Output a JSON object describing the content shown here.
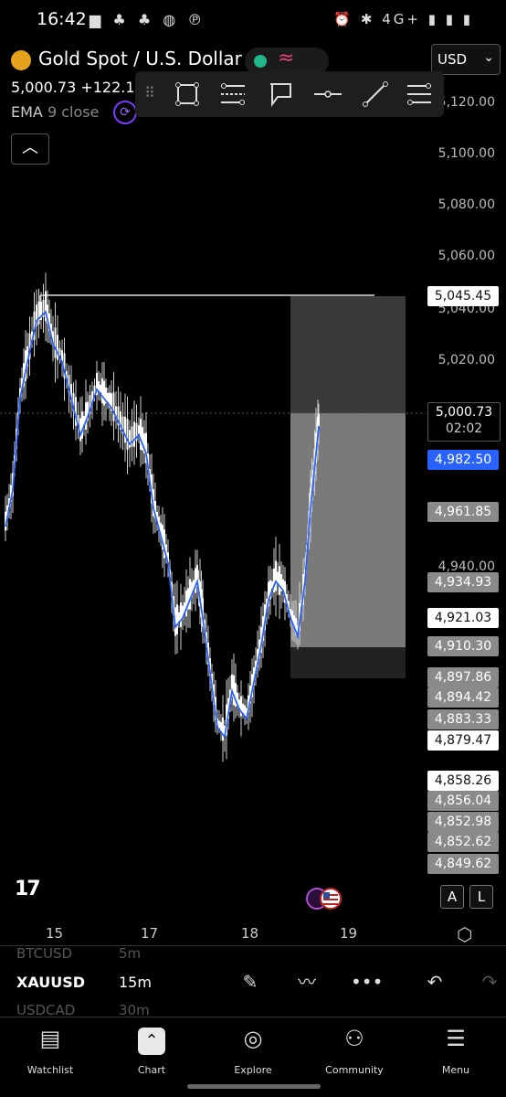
{
  "status": {
    "time": "16:42",
    "left_icons": "▆ ♣ ♣ ◍ ℗",
    "right_icons": "⏰ ✱ 4G+ ▮ ▮ ▮"
  },
  "header": {
    "title": "Gold Spot / U.S. Dollar",
    "price": "5,000.73",
    "change": "+122.12",
    "indicator": "EMA",
    "indicator_period": "9",
    "indicator_source": "close",
    "currency": "USD"
  },
  "price_axis": {
    "labels": [
      "5,120.00",
      "5,100.00",
      "5,080.00",
      "5,060.00",
      "5,040.00",
      "5,020.00",
      "4,940.00"
    ]
  },
  "price_tags": [
    {
      "value": "5,045.45",
      "style": "white"
    },
    {
      "value": "4,982.50",
      "style": "blue"
    },
    {
      "value": "4,961.85",
      "style": "gray"
    },
    {
      "value": "4,934.93",
      "style": "gray"
    },
    {
      "value": "4,921.03",
      "style": "white"
    },
    {
      "value": "4,910.30",
      "style": "gray"
    },
    {
      "value": "4,897.86",
      "style": "gray"
    },
    {
      "value": "4,894.42",
      "style": "gray"
    },
    {
      "value": "4,883.33",
      "style": "gray"
    },
    {
      "value": "4,879.47",
      "style": "white"
    },
    {
      "value": "4,858.26",
      "style": "white"
    },
    {
      "value": "4,856.04",
      "style": "gray"
    },
    {
      "value": "4,852.98",
      "style": "gray"
    },
    {
      "value": "4,852.62",
      "style": "gray"
    },
    {
      "value": "4,849.62",
      "style": "gray"
    }
  ],
  "current_price": {
    "value": "5,000.73",
    "countdown": "02:02"
  },
  "time_axis": {
    "labels": [
      "15",
      "17",
      "18",
      "19"
    ]
  },
  "chart_buttons": {
    "alert": "A",
    "log": "L"
  },
  "logo_text": "17",
  "symbols": {
    "prev_symbol": "BTCUSD",
    "prev_interval": "5m",
    "symbol": "XAUUSD",
    "interval": "15m",
    "next_symbol": "USDCAD",
    "next_interval": "30m"
  },
  "nav": [
    {
      "label": "Watchlist",
      "icon": "watchlist-icon"
    },
    {
      "label": "Chart",
      "icon": "chart-icon"
    },
    {
      "label": "Explore",
      "icon": "compass-icon"
    },
    {
      "label": "Community",
      "icon": "people-icon"
    },
    {
      "label": "Menu",
      "icon": "menu-icon"
    }
  ],
  "colors": {
    "ema_line": "#2962ff",
    "candle": "#ffffff",
    "gold": "#e6a21c",
    "accent_green": "#21b68a"
  }
}
